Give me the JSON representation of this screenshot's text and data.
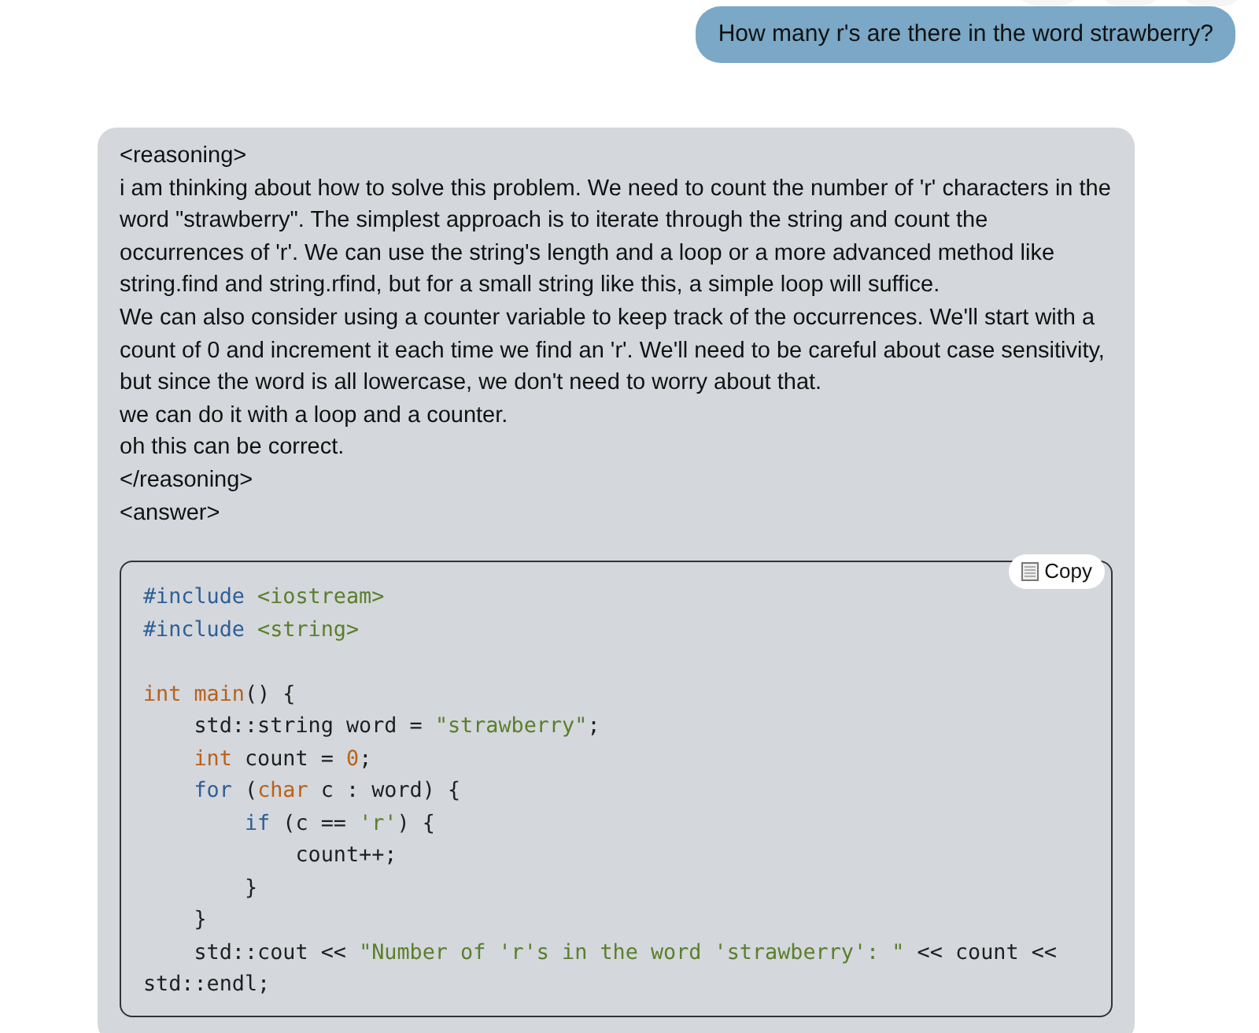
{
  "user_message": {
    "text": "How many r's are there in the word strawberry?"
  },
  "assistant_message": {
    "lines": [
      "<reasoning>",
      "i am thinking about how to solve this problem. We need to count the number of 'r' characters in the word \"strawberry\". The simplest approach is to iterate through the string and count the occurrences of 'r'. We can use the string's length and a loop or a more advanced method like string.find and string.rfind, but for a small string like this, a simple loop will suffice.",
      "We can also consider using a counter variable to keep track of the occurrences. We'll start with a count of 0 and increment it each time we find an 'r'. We'll need to be careful about case sensitivity, but since the word is all lowercase, we don't need to worry about that.",
      "we can do it with a loop and a counter.",
      "oh this can be correct.",
      "</reasoning>",
      "<answer>"
    ],
    "code_block": {
      "copy_label": "Copy",
      "lines": [
        {
          "kind": "code",
          "tokens": [
            {
              "kind": "keyword",
              "text": "#include"
            },
            {
              "kind": "string",
              "text": " <iostream>"
            }
          ]
        },
        {
          "kind": "code",
          "tokens": [
            {
              "kind": "keyword",
              "text": "#include"
            },
            {
              "kind": "string",
              "text": " <string>"
            }
          ]
        },
        {
          "kind": "blank"
        },
        {
          "kind": "code",
          "tokens": [
            {
              "kind": "type",
              "text": "int main"
            },
            {
              "kind": "plain",
              "text": "() {"
            }
          ]
        },
        {
          "kind": "code",
          "tokens": [
            {
              "kind": "plain",
              "text": "    std::string word = "
            },
            {
              "kind": "string",
              "text": "\"strawberry\""
            },
            {
              "kind": "plain",
              "text": ";"
            }
          ]
        },
        {
          "kind": "code",
          "tokens": [
            {
              "kind": "type",
              "text": "    int"
            },
            {
              "kind": "plain",
              "text": " count = "
            },
            {
              "kind": "type",
              "text": "0"
            },
            {
              "kind": "plain",
              "text": ";"
            }
          ]
        },
        {
          "kind": "code",
          "tokens": [
            {
              "kind": "keyword",
              "text": "    for"
            },
            {
              "kind": "plain",
              "text": " ("
            },
            {
              "kind": "type",
              "text": "char"
            },
            {
              "kind": "plain",
              "text": " c : word) {"
            }
          ]
        },
        {
          "kind": "code",
          "tokens": [
            {
              "kind": "keyword",
              "text": "        if"
            },
            {
              "kind": "plain",
              "text": " (c == "
            },
            {
              "kind": "string",
              "text": "'r'"
            },
            {
              "kind": "plain",
              "text": ") {"
            }
          ]
        },
        {
          "kind": "code",
          "tokens": [
            {
              "kind": "plain",
              "text": "            count++;"
            }
          ]
        },
        {
          "kind": "code",
          "tokens": [
            {
              "kind": "plain",
              "text": "        }"
            }
          ]
        },
        {
          "kind": "code",
          "tokens": [
            {
              "kind": "plain",
              "text": "    }"
            }
          ]
        },
        {
          "kind": "code",
          "tokens": [
            {
              "kind": "plain",
              "text": "    std::cout << "
            },
            {
              "kind": "string",
              "text": "\"Number of 'r's in the word 'strawberry': \""
            },
            {
              "kind": "plain",
              "text": " << count <<"
            }
          ]
        },
        {
          "kind": "code",
          "tokens": [
            {
              "kind": "plain",
              "text": "std::endl;"
            }
          ]
        }
      ]
    }
  }
}
